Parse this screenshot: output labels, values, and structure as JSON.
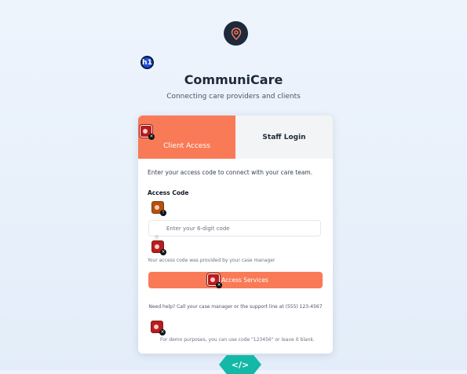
{
  "app": {
    "title": "CommuniCare",
    "subtitle": "Connecting care providers and clients",
    "heading_badge": "h1",
    "logo_icon": "map-pin-icon"
  },
  "tabs": [
    {
      "label": "Client Access",
      "active": true
    },
    {
      "label": "Staff Login",
      "active": false
    }
  ],
  "form": {
    "intro": "Enter your access code to connect with your care team.",
    "field_label": "Access Code",
    "placeholder": "Enter your 6-digit code",
    "value": "",
    "help": "Your access code was provided by your case manager",
    "submit_label": "Access Services"
  },
  "footer": {
    "support": "Need help? Call your case manager or the support line at (555) 123-4567",
    "demo_note": "For demo purposes, you can use code \"123456\" or leave it blank."
  },
  "dev_badge": "</>",
  "colors": {
    "accent": "#f97a56",
    "dark": "#1e293b",
    "background": "#e8f0fb"
  }
}
